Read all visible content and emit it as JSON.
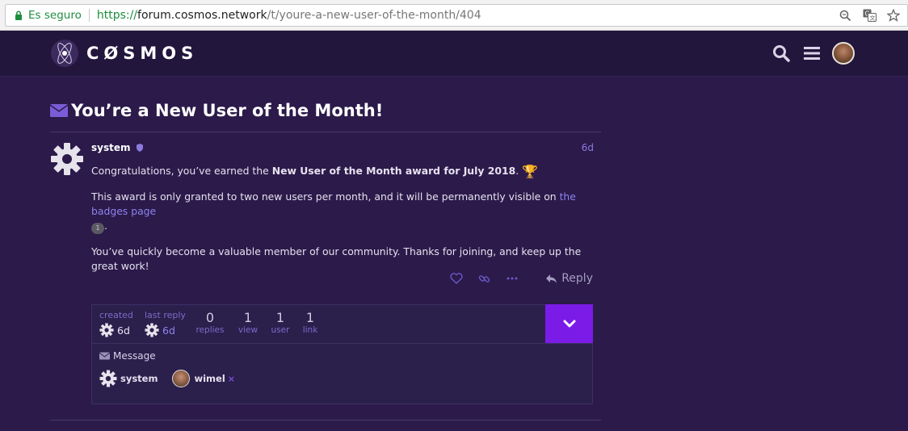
{
  "browser": {
    "secure_label": "Es seguro",
    "url_scheme": "https://",
    "url_host": "forum.cosmos.network",
    "url_path": "/t/youre-a-new-user-of-the-month/404",
    "icons": [
      "lock-icon",
      "zoom-icon",
      "translate-icon",
      "star-icon"
    ]
  },
  "header": {
    "logo_text": "CØSMOS",
    "icons": [
      "search-icon",
      "hamburger-menu-icon",
      "user-avatar"
    ]
  },
  "topic": {
    "title": "You’re a New User of the Month!"
  },
  "post": {
    "username": "system",
    "date": "6d",
    "p1_before": "Congratulations, you’ve earned the ",
    "p1_bold": "New User of the Month award for July 2018",
    "p1_after": ".",
    "p2_before": "This award is only granted to two new users per month, and it will be permanently visible on ",
    "p2_link": "the badges page",
    "p2_badge_count": "1",
    "p2_after": ".",
    "p3": "You’ve quickly become a valuable member of our community. Thanks for joining, and keep up the great work!",
    "reply_label": "Reply"
  },
  "topic_map": {
    "created_label": "created",
    "created_value": "6d",
    "last_reply_label": "last reply",
    "last_reply_value": "6d",
    "stats": [
      {
        "num": "0",
        "label": "replies"
      },
      {
        "num": "1",
        "label": "view"
      },
      {
        "num": "1",
        "label": "user"
      },
      {
        "num": "1",
        "label": "link"
      }
    ],
    "message_label": "Message",
    "participants": [
      {
        "name": "system"
      },
      {
        "name": "wimel",
        "remove": "×"
      }
    ]
  },
  "colors": {
    "page_bg": "#2b1a4a",
    "header_bg": "#22163c",
    "accent": "#7b1be8",
    "link": "#8f83ee"
  }
}
